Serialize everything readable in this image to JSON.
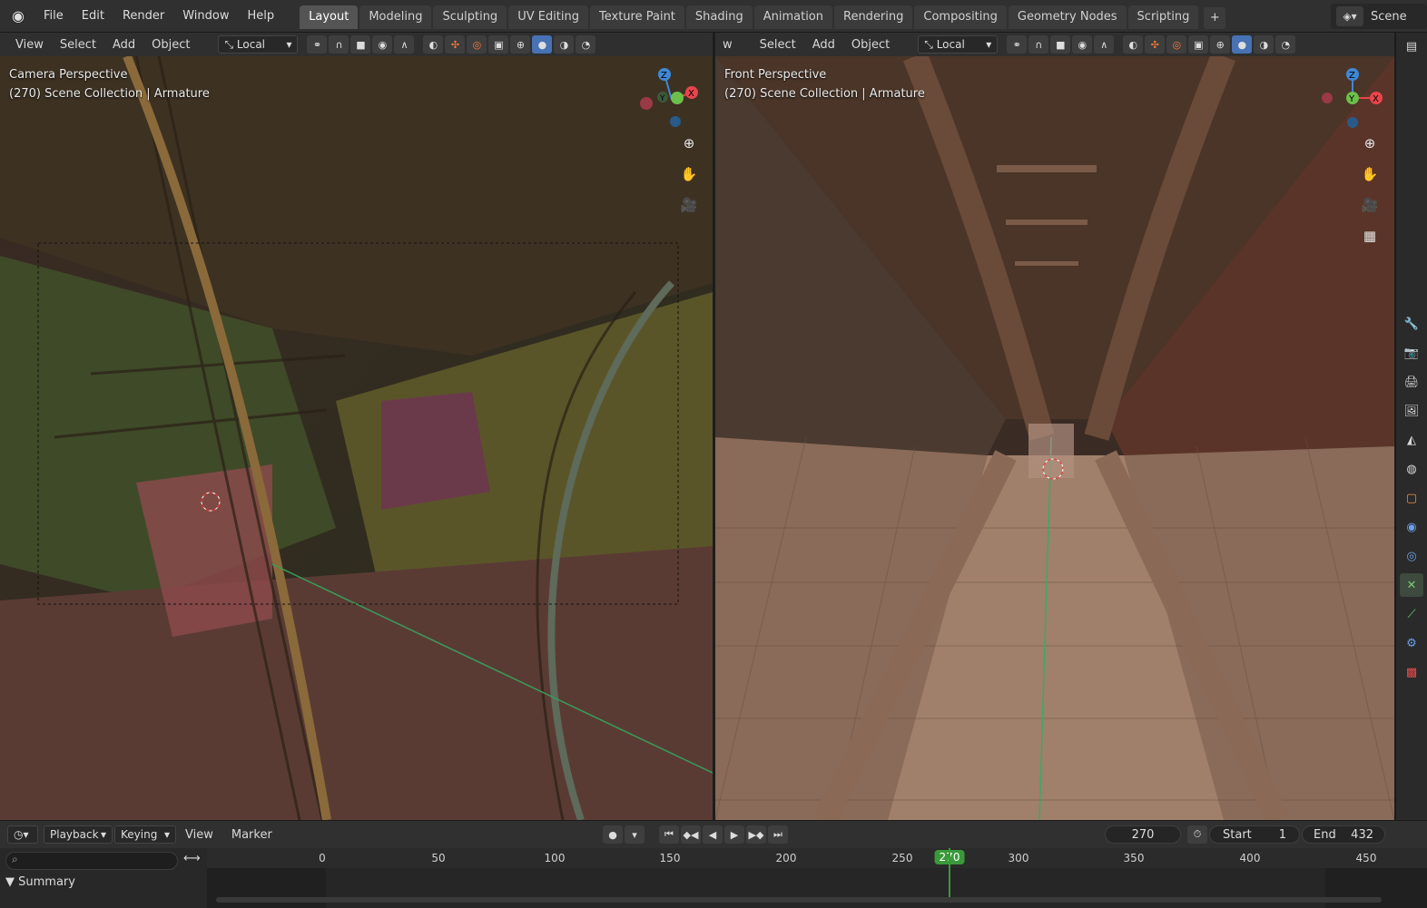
{
  "menu": {
    "file": "File",
    "edit": "Edit",
    "render": "Render",
    "window": "Window",
    "help": "Help"
  },
  "workspaces": [
    "Layout",
    "Modeling",
    "Sculpting",
    "UV Editing",
    "Texture Paint",
    "Shading",
    "Animation",
    "Rendering",
    "Compositing",
    "Geometry Nodes",
    "Scripting"
  ],
  "active_workspace": "Layout",
  "scene_name": "Scene",
  "viewport_left": {
    "menus": [
      "View",
      "Select",
      "Add",
      "Object"
    ],
    "transform_orientation": "Local",
    "overlay_title": "Camera Perspective",
    "overlay_sub": "(270) Scene Collection | Armature"
  },
  "viewport_right": {
    "menus": [
      "w",
      "Select",
      "Add",
      "Object"
    ],
    "transform_orientation": "Local",
    "overlay_title": "Front Perspective",
    "overlay_sub": "(270) Scene Collection | Armature"
  },
  "gizmo_labels": {
    "x": "X",
    "y": "Y",
    "z": "Z"
  },
  "timeline": {
    "menus": [
      "Playback",
      "Keying",
      "View",
      "Marker"
    ],
    "current_frame": "270",
    "start_label": "Start",
    "start": "1",
    "end_label": "End",
    "end": "432",
    "ruler": [
      "0",
      "50",
      "100",
      "150",
      "200",
      "250",
      "300",
      "350",
      "400",
      "450"
    ],
    "summary": "Summary"
  },
  "colors": {
    "accent": "#4772b3",
    "playhead": "#3a9a3a",
    "axis_x": "#e8454d",
    "axis_y": "#6cc04a",
    "axis_z": "#3f88d6"
  }
}
